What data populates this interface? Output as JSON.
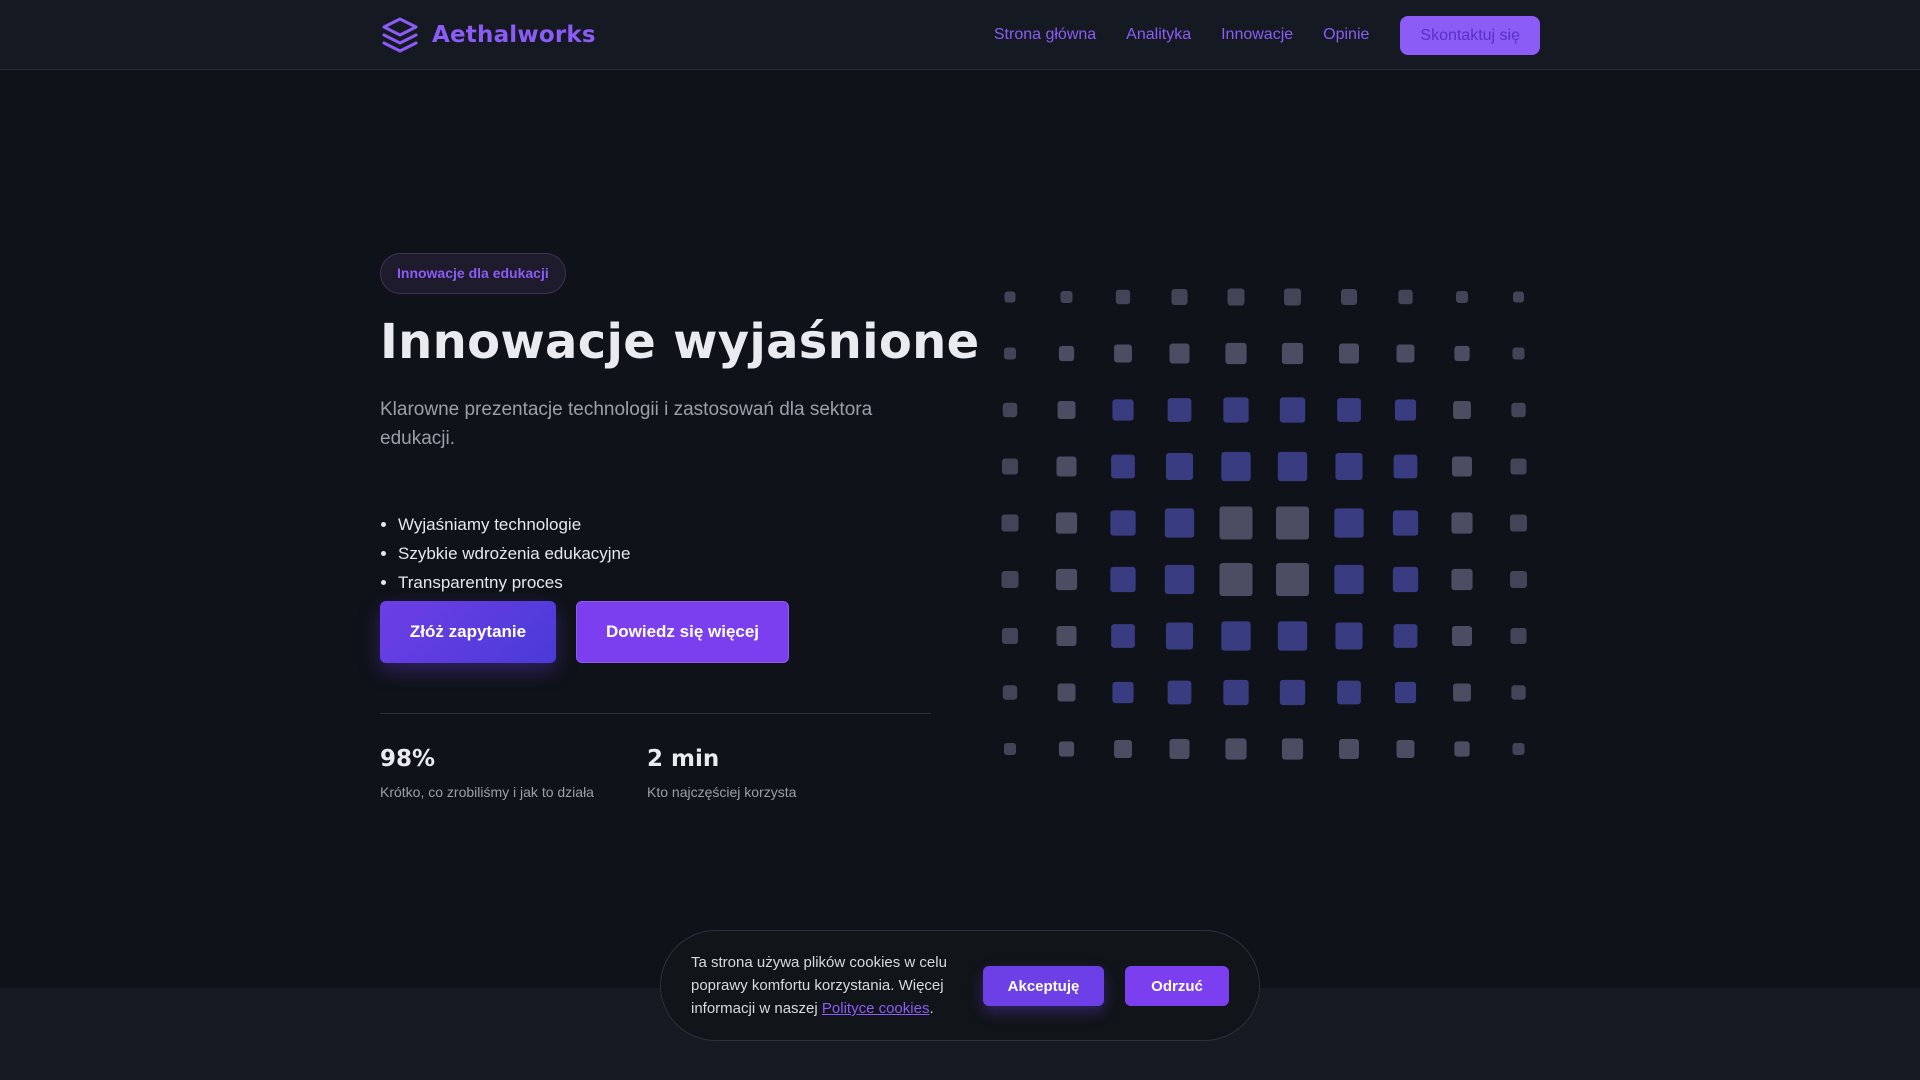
{
  "brand": {
    "name": "Aethalworks",
    "logo_icon": "layers-icon",
    "accent": "#8b5cf6"
  },
  "nav": {
    "items": [
      "Strona główna",
      "Analityka",
      "Innowacje",
      "Opinie"
    ],
    "cta": "Skontaktuj się"
  },
  "hero": {
    "badge": "Innowacje dla edukacji",
    "title": "Innowacje wyjaśnione",
    "subtitle": "Klarowne prezentacje technologii i zastosowań dla sektora edukacji.",
    "features": [
      "Wyjaśniamy technologie",
      "Szybkie wdrożenia edukacyjne",
      "Transparentny proces"
    ],
    "primary_button": "Złóż zapytanie",
    "secondary_button": "Dowiedz się więcej"
  },
  "stats": [
    {
      "value": "98%",
      "label": "Krótko, co zrobiliśmy i jak to działa"
    },
    {
      "value": "2 min",
      "label": "Kto najczęściej korzysta"
    }
  ],
  "cookie": {
    "text_before": "Ta strona używa plików cookies w celu poprawy komfortu korzystania. Więcej informacji w naszej ",
    "link": "Polityce cookies",
    "text_after": ".",
    "accept": "Akceptuję",
    "reject": "Odrzuć"
  },
  "colors": {
    "background": "#0f1218",
    "header": "#151921",
    "tile_blue": "#3a3c82",
    "tile_gray": "#4b4d63"
  }
}
